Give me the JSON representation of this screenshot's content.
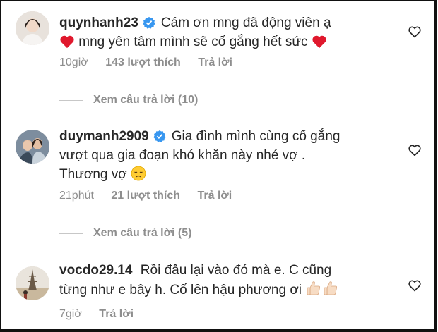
{
  "comments": [
    {
      "username": "quynhanh23",
      "verified": true,
      "text_part1": "Cám ơn mng đã động viên ạ",
      "text_part2": "mng yên tâm mình sẽ cố gắng hết sức",
      "time": "10giờ",
      "likes": "143 lượt thích",
      "reply": "Trả lời",
      "view_replies": "Xem câu trả lời (10)"
    },
    {
      "username": "duymanh2909",
      "verified": true,
      "text_line1": "Gia đình mình cùng cố gắng",
      "text_line2": "vượt qua gia đoạn khó khăn này nhé vợ .",
      "text_line3": "Thương vợ",
      "time": "21phút",
      "likes": "21 lượt thích",
      "reply": "Trả lời",
      "view_replies": "Xem câu trả lời (5)"
    },
    {
      "username": "vocdo29.14",
      "verified": false,
      "text_line1": "Rồi đâu lại vào đó mà e. C cũng",
      "text_line2": "từng như e bây h. Cố lên hậu phương ơi",
      "time": "7giờ",
      "reply": "Trả lời"
    }
  ],
  "icons": {
    "verified": "verified-badge-icon",
    "heart": "red-heart-emoji",
    "like": "heart-outline-icon",
    "sad": "disappointed-face-emoji",
    "thumbs": "thumbs-up-emoji"
  },
  "colors": {
    "text": "#262626",
    "muted": "#8e8e8e",
    "verified": "#3897f0",
    "heart": "#ed4956"
  }
}
